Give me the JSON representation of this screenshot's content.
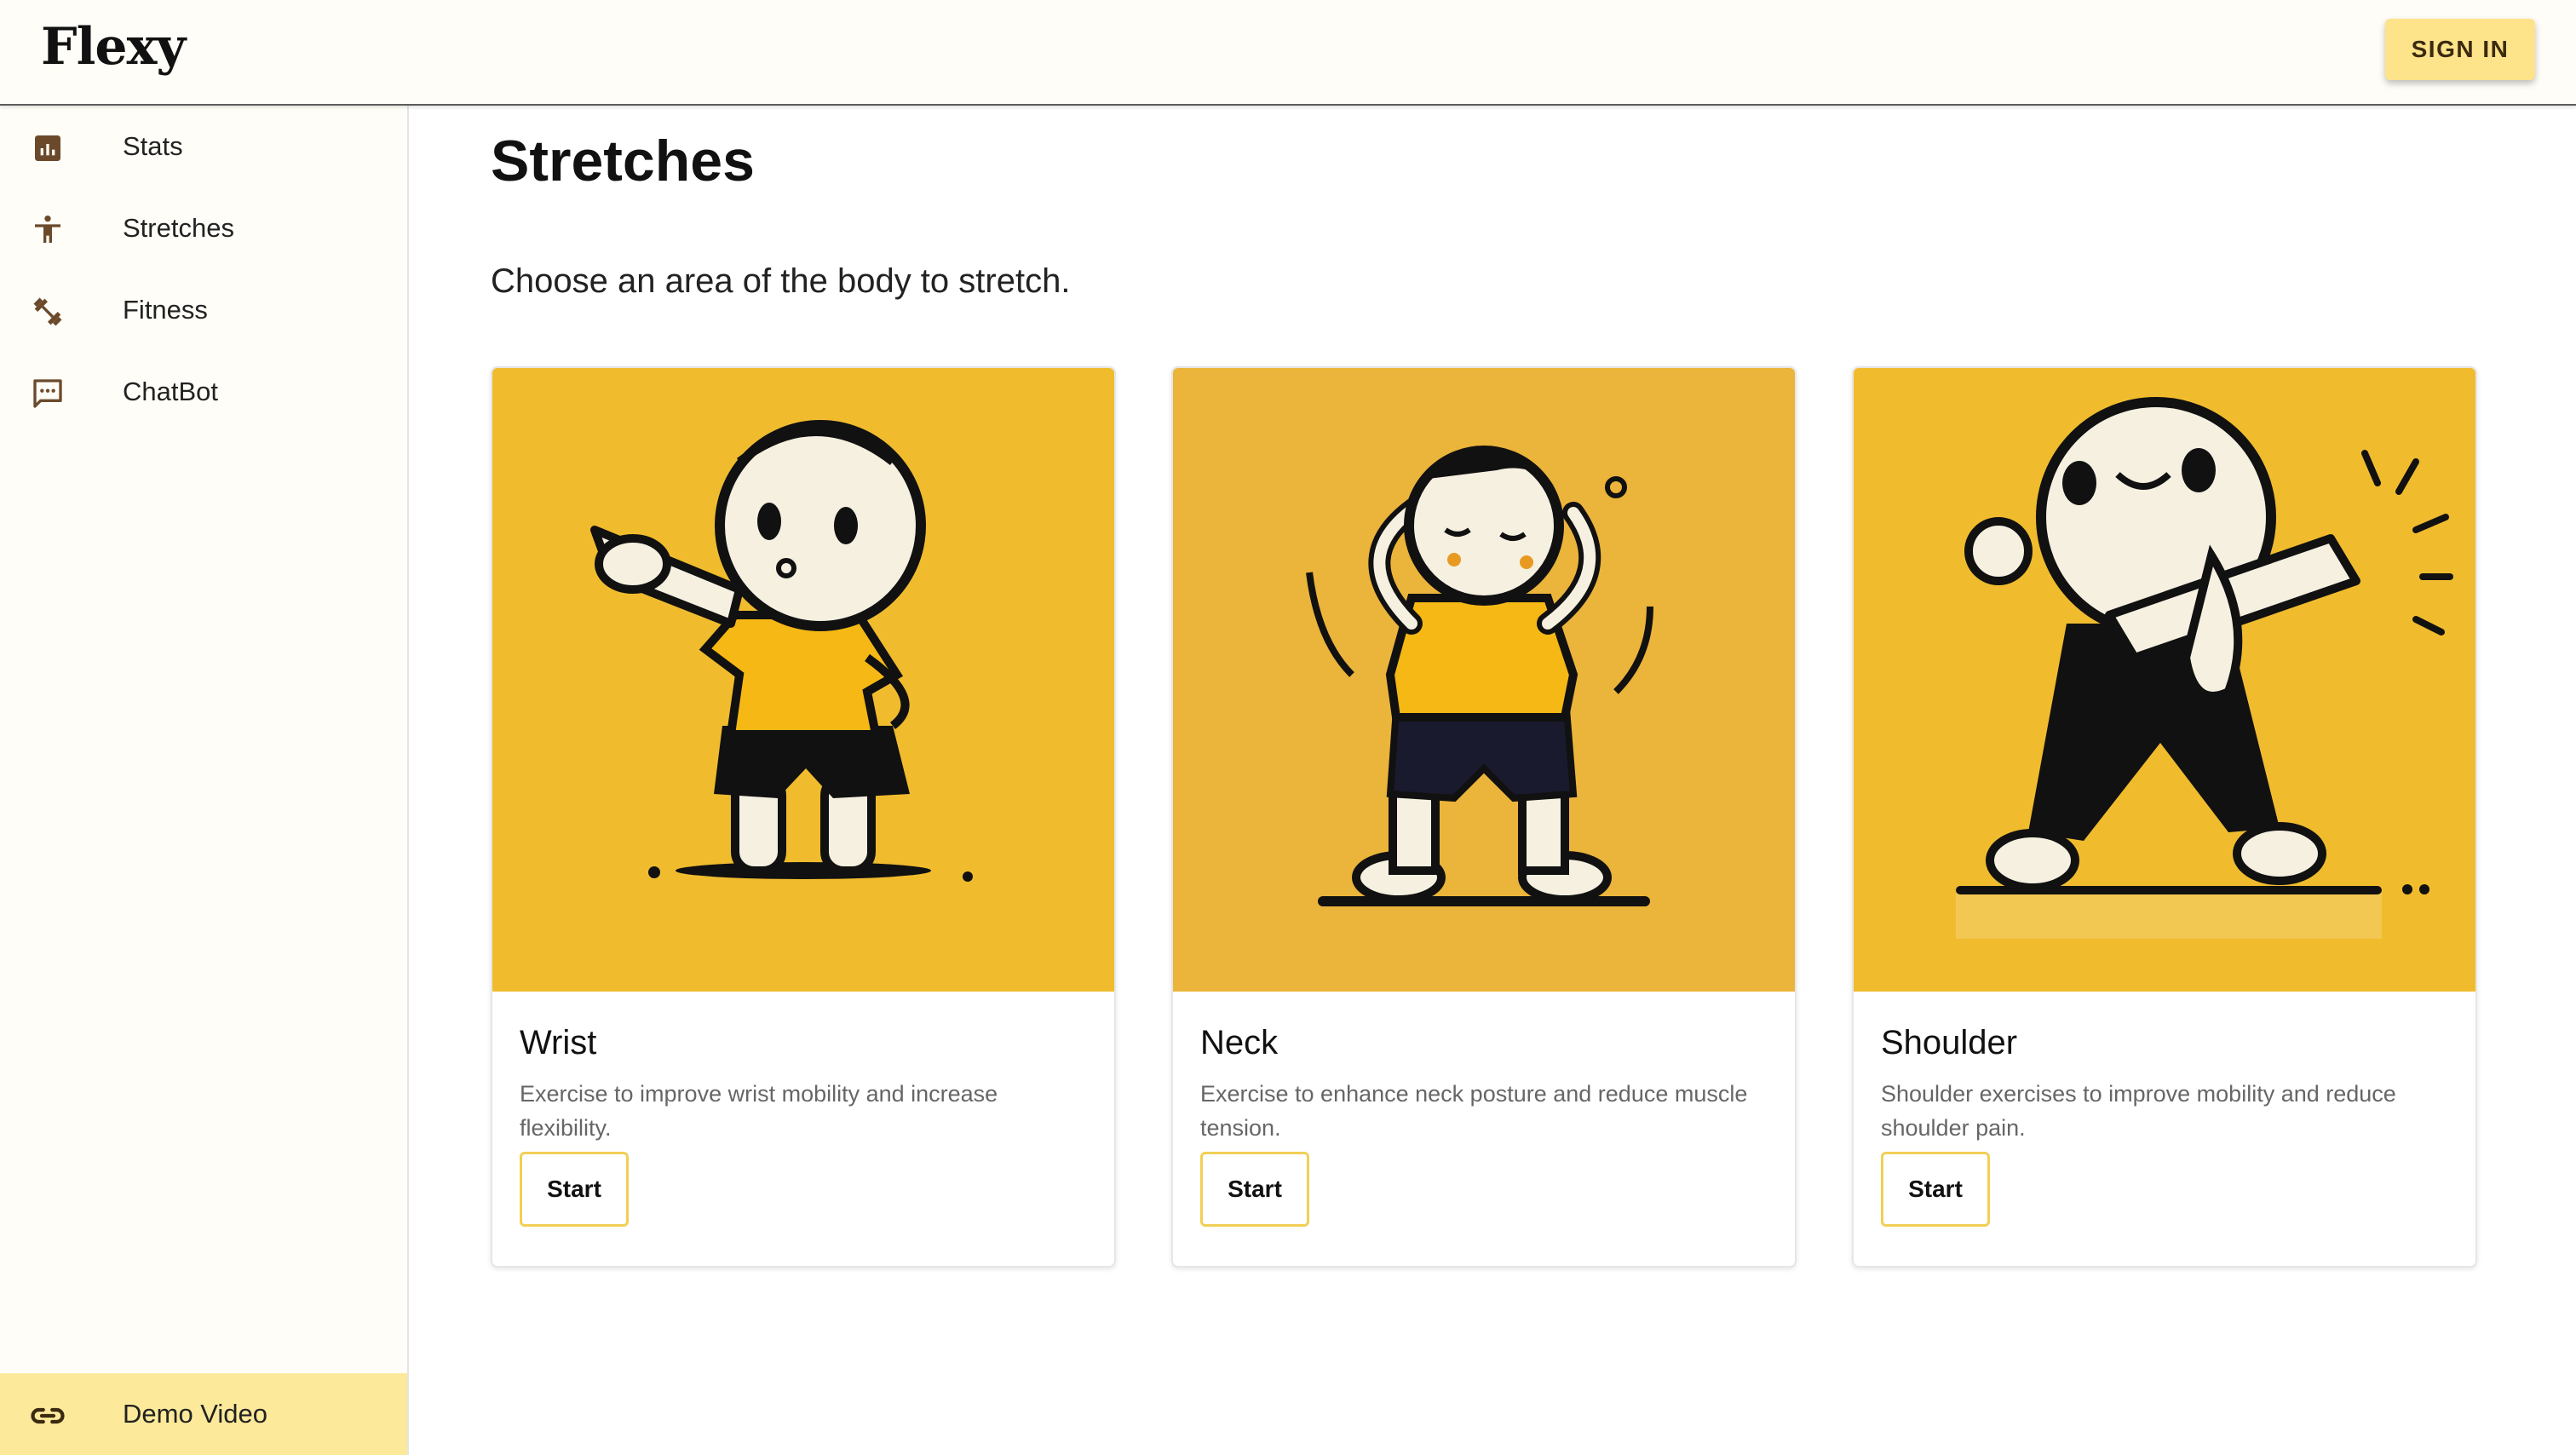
{
  "app": {
    "title": "Flexy"
  },
  "header": {
    "signin_label": "SIGN IN"
  },
  "sidebar": {
    "items": [
      {
        "label": "Stats",
        "icon": "bar-chart-icon"
      },
      {
        "label": "Stretches",
        "icon": "accessibility-person-icon"
      },
      {
        "label": "Fitness",
        "icon": "dumbbell-icon"
      },
      {
        "label": "ChatBot",
        "icon": "chat-bubble-icon"
      }
    ],
    "footer": {
      "label": "Demo Video",
      "icon": "link-icon"
    }
  },
  "main": {
    "title": "Stretches",
    "subtitle": "Choose an area of the body to stretch.",
    "cards": [
      {
        "title": "Wrist",
        "description": "Exercise to improve wrist mobility and increase flexibility.",
        "button": "Start"
      },
      {
        "title": "Neck",
        "description": "Exercise to enhance neck posture and reduce muscle tension.",
        "button": "Start"
      },
      {
        "title": "Shoulder",
        "description": "Shoulder exercises to improve mobility and reduce shoulder pain.",
        "button": "Start"
      }
    ]
  },
  "colors": {
    "accent": "#fde389",
    "sidebar_bg": "#fffdf7",
    "demo_bg": "#fde99a",
    "card_art_bg": "#f0bc2e",
    "button_border": "#f2cf55",
    "icon_brown": "#6b4a2b"
  }
}
